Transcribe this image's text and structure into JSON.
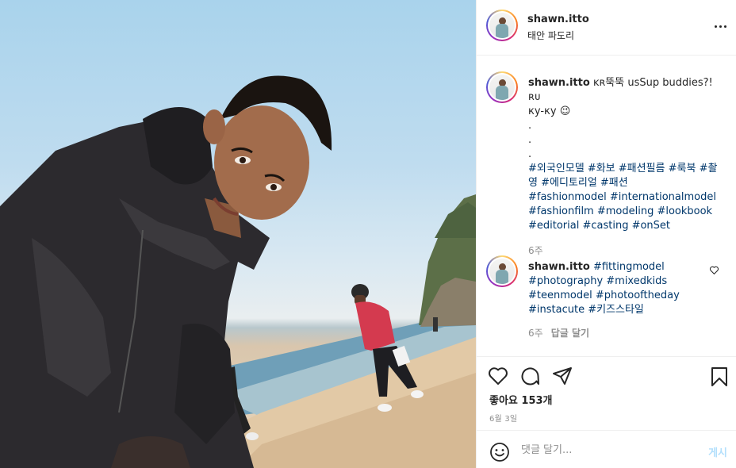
{
  "post": {
    "username": "shawn.itto",
    "location": "태안 파도리"
  },
  "caption": {
    "username": "shawn.itto",
    "text_line1": "ᴋʀ뚝뚝 usSup buddies?! ʀᴜ",
    "text_line2": "кy-кy",
    "emoji": "😉",
    "dots": [
      ".",
      ".",
      "."
    ],
    "hashtags_line1": "#외국인모델 #화보 #패션필름 #룩북 #촬영 #에디토리얼 #패션",
    "hashtags_line2": "#fashionmodel #internationalmodel",
    "hashtags_line3": "#fashionfilm #modeling #lookbook",
    "hashtags_line4": "#editorial #casting #onSet",
    "time": "6주"
  },
  "comment": {
    "username": "shawn.itto",
    "line1": "#fittingmodel",
    "line2": "#photography #mixedkids",
    "line3": "#teenmodel #photooftheday",
    "line4": "#instacute #키즈스타일",
    "time": "6주",
    "reply_label": "답글 달기"
  },
  "likes": "좋아요 153개",
  "date": "6월 3일",
  "add_comment": {
    "placeholder": "댓글 달기...",
    "post_label": "게시"
  },
  "colors": {
    "hashtag": "#00376b",
    "muted": "#8e8e8e",
    "post_disabled": "#b2dffc"
  },
  "icons": [
    "more-options-icon",
    "heart-icon",
    "comment-icon",
    "share-icon",
    "bookmark-icon",
    "emoji-icon",
    "small-heart-icon"
  ]
}
